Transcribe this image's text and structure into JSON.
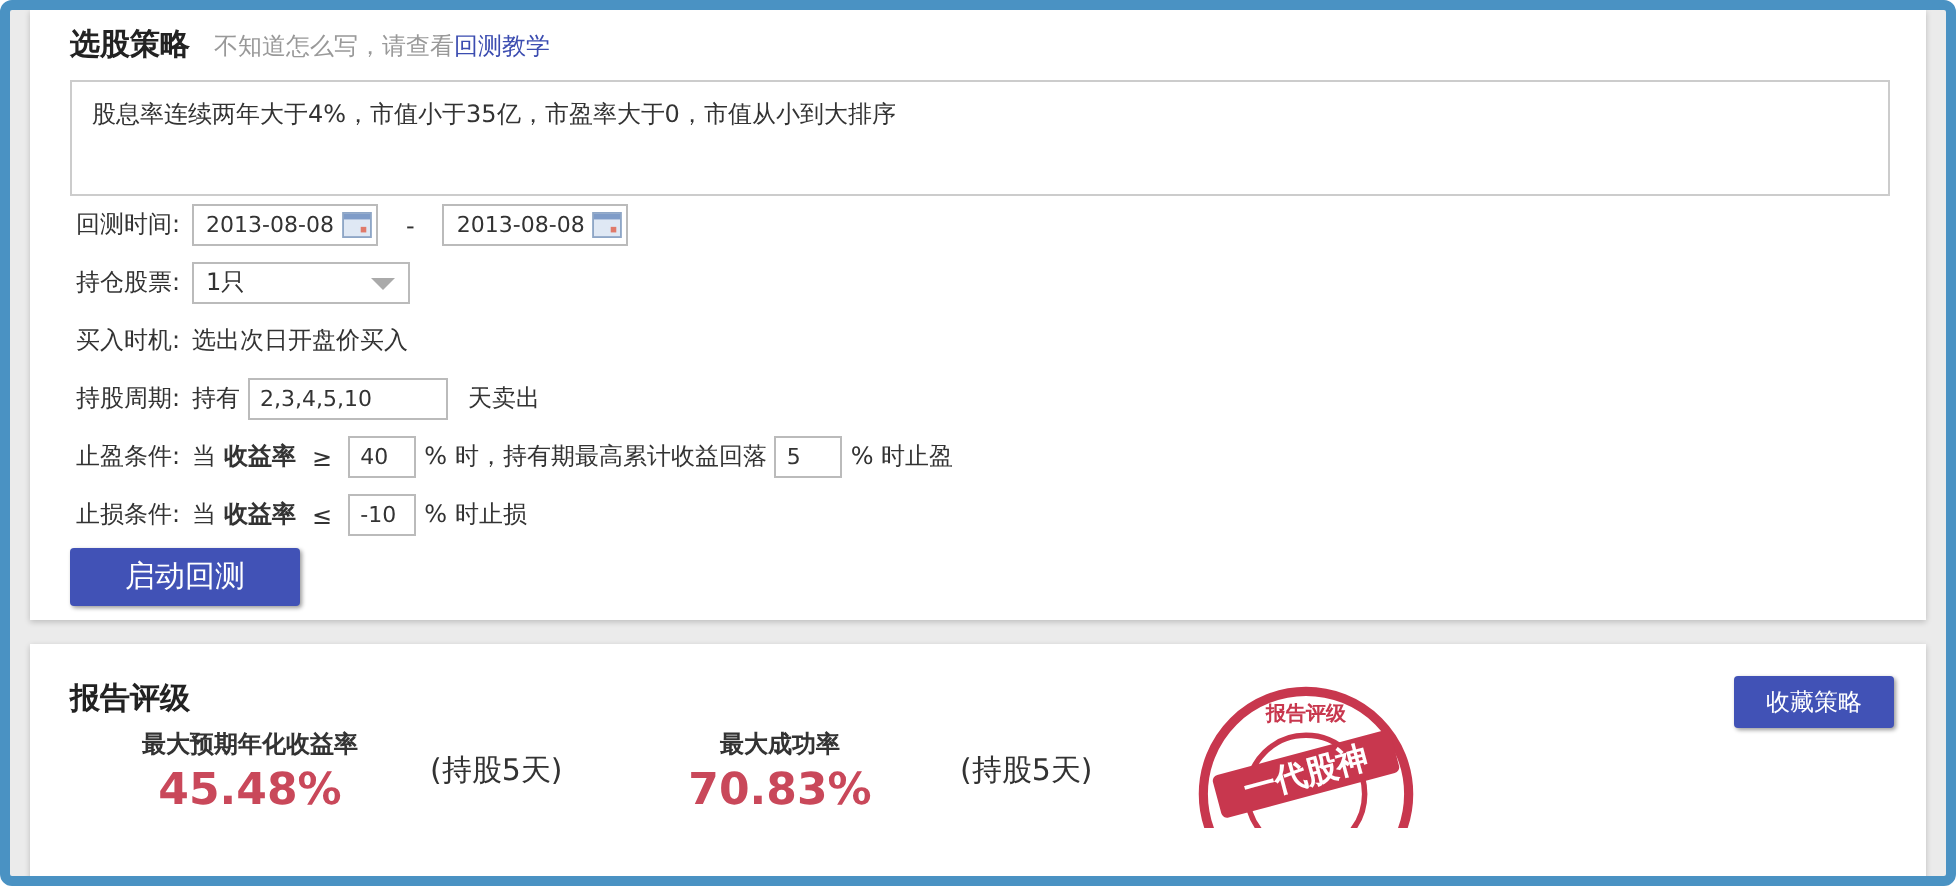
{
  "strategy": {
    "title": "选股策略",
    "hint": "不知道怎么写，请查看",
    "hint_link": "回测教学",
    "query": "股息率连续两年大于4%，市值小于35亿，市盈率大于0，市值从小到大排序"
  },
  "form": {
    "date_label": "回测时间:",
    "date_from": "2013-08-08",
    "date_sep": "-",
    "date_to": "2013-08-08",
    "hold_label": "持仓股票:",
    "hold_value": "1只",
    "buy_label": "买入时机:",
    "buy_text": "选出次日开盘价买入",
    "period_label": "持股周期:",
    "period_prefix": "持有",
    "period_value": "2,3,4,5,10",
    "period_suffix": "天卖出",
    "profit_label": "止盈条件:",
    "profit_when": "当",
    "profit_metric": "收益率",
    "profit_op": "≥",
    "profit_value": "40",
    "profit_mid": "% 时，持有期最高累计收益回落",
    "profit_drop": "5",
    "profit_end": "% 时止盈",
    "loss_label": "止损条件:",
    "loss_when": "当",
    "loss_metric": "收益率",
    "loss_op": "≤",
    "loss_value": "-10",
    "loss_end": "% 时止损",
    "start_button": "启动回测"
  },
  "report": {
    "title": "报告评级",
    "save_button": "收藏策略",
    "metrics": [
      {
        "label": "最大预期年化收益率",
        "value": "45.48%",
        "note": "(持股5天)"
      },
      {
        "label": "最大成功率",
        "value": "70.83%",
        "note": "(持股5天)"
      }
    ],
    "stamp": {
      "ring_text": "报告评级",
      "banner_text": "一代股神"
    }
  }
}
